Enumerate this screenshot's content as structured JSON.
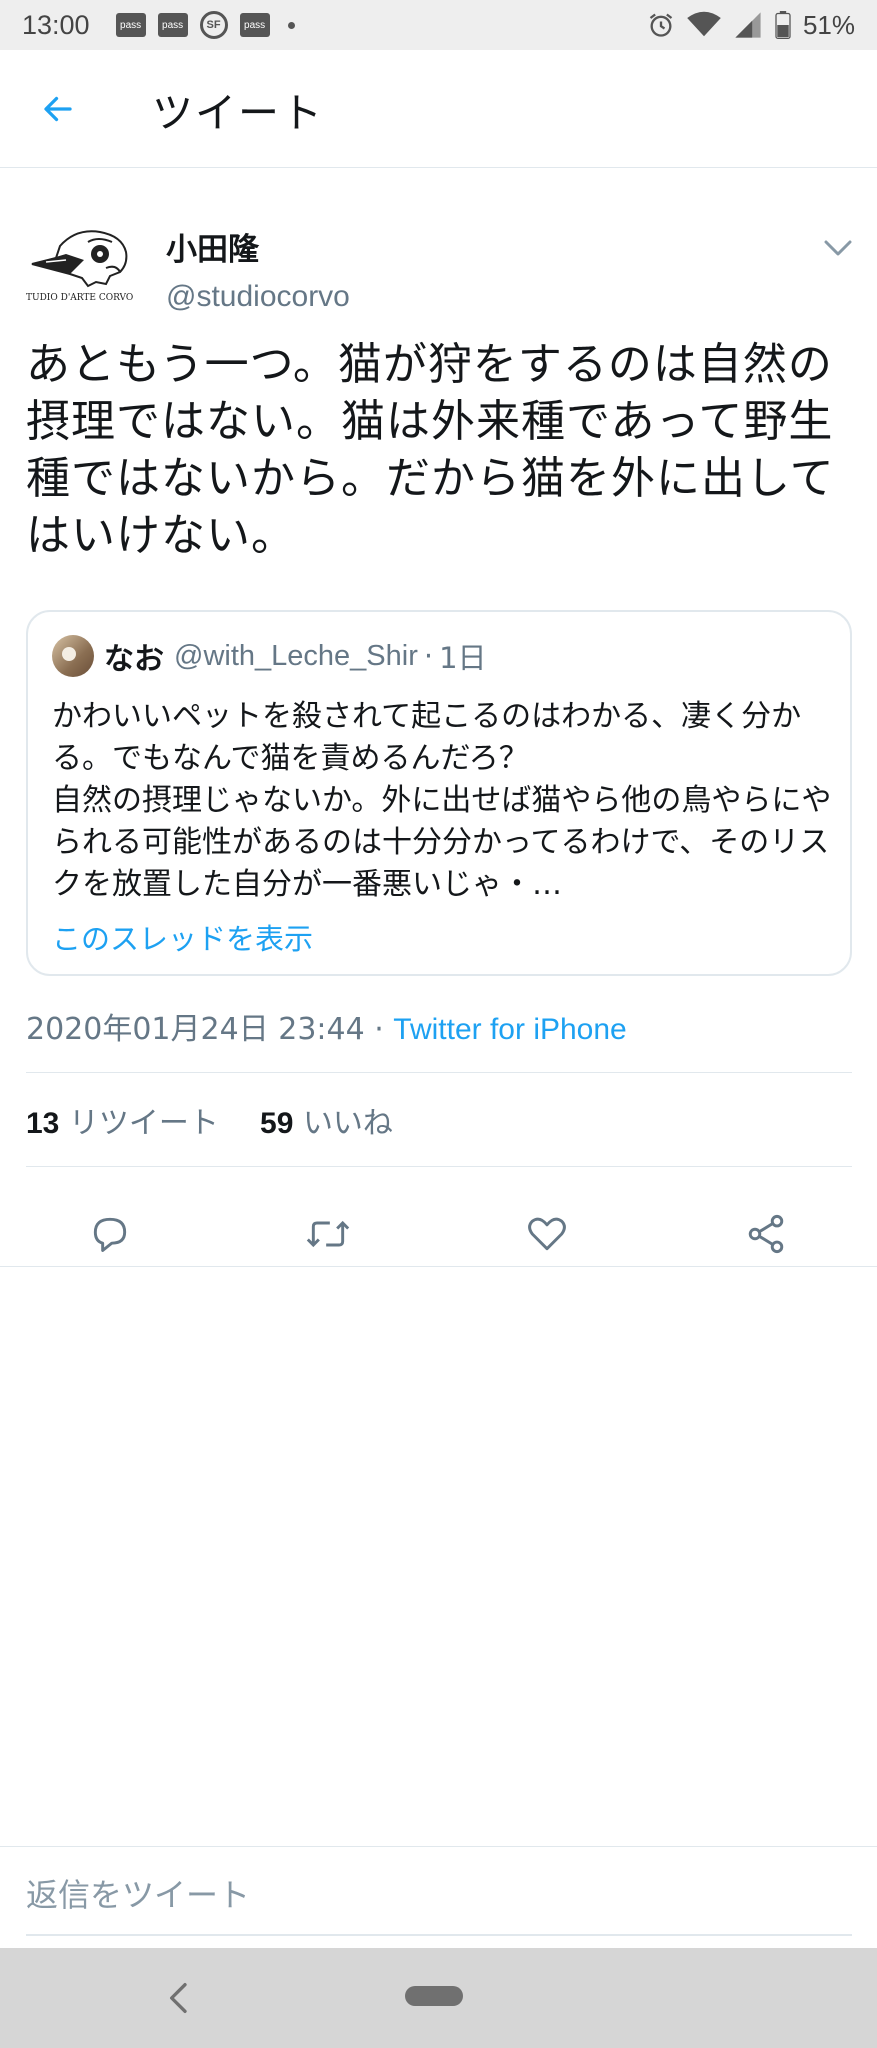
{
  "status_bar": {
    "time": "13:00",
    "notifications": [
      {
        "icon": "pass-icon",
        "text": "pass"
      },
      {
        "icon": "pass-icon",
        "text": "pass"
      },
      {
        "icon": "sf-icon",
        "text": "SF"
      },
      {
        "icon": "pass-icon",
        "text": "pass"
      }
    ],
    "battery": "51%"
  },
  "header": {
    "title": "ツイート"
  },
  "tweet": {
    "author_name": "小田隆",
    "author_handle": "@studiocorvo",
    "avatar_caption": "TUDIO D'ARTE CORVO",
    "text": "あともう一つ。猫が狩をするのは自然の摂理ではない。猫は外来種であって野生種ではないから。だから猫を外に出してはいけない。",
    "quoted": {
      "name": "なお",
      "handle": "@with_Leche_Shir",
      "separator": "·",
      "time": "1日",
      "text": "かわいいペットを殺されて起こるのはわかる、凄く分かる。でもなんで猫を責めるんだろ？\n自然の摂理じゃないか。外に出せば猫やら他の鳥やらにやられる可能性があるのは十分分かってるわけで、そのリスクを放置した自分が一番悪いじゃ・…",
      "thread_link": "このスレッドを表示"
    },
    "timestamp": "2020年01月24日 23:44",
    "meta_separator": " · ",
    "source": "Twitter for iPhone",
    "retweets_count": "13",
    "retweets_label": "リツイート",
    "likes_count": "59",
    "likes_label": "いいね"
  },
  "reply": {
    "placeholder": "返信をツイート"
  },
  "colors": {
    "accent": "#1da1f2",
    "secondary_text": "#657786",
    "border": "#e1e8ed"
  }
}
